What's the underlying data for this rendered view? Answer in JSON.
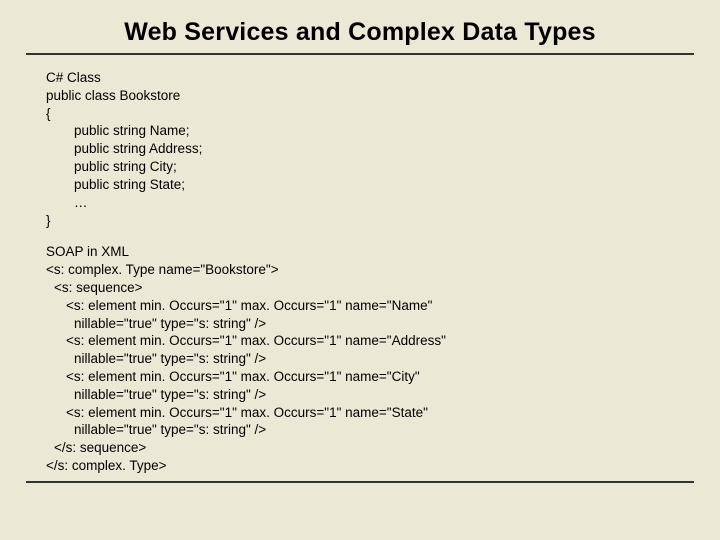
{
  "title": "Web Services and Complex Data Types",
  "csharp": {
    "heading": "C# Class",
    "decl": "public class Bookstore",
    "open": "{",
    "lines": [
      "public string Name;",
      "public string Address;",
      "public string City;",
      "public string State;",
      "…"
    ],
    "close": "}"
  },
  "soap": {
    "heading": "SOAP in XML",
    "open": "<s: complex. Type name=\"Bookstore\">",
    "seqOpen": "<s: sequence>",
    "elements": [
      {
        "line1": "<s: element min. Occurs=\"1\" max. Occurs=\"1\" name=\"Name\"",
        "line2": "nillable=\"true\" type=\"s: string\" />"
      },
      {
        "line1": "<s: element min. Occurs=\"1\" max. Occurs=\"1\" name=\"Address\"",
        "line2": "nillable=\"true\" type=\"s: string\" />"
      },
      {
        "line1": "<s: element min. Occurs=\"1\" max. Occurs=\"1\" name=\"City\"",
        "line2": "nillable=\"true\" type=\"s: string\" />"
      },
      {
        "line1": "<s: element min. Occurs=\"1\" max. Occurs=\"1\" name=\"State\"",
        "line2": "nillable=\"true\" type=\"s: string\" />"
      }
    ],
    "seqClose": "</s: sequence>",
    "close": "</s: complex. Type>"
  }
}
